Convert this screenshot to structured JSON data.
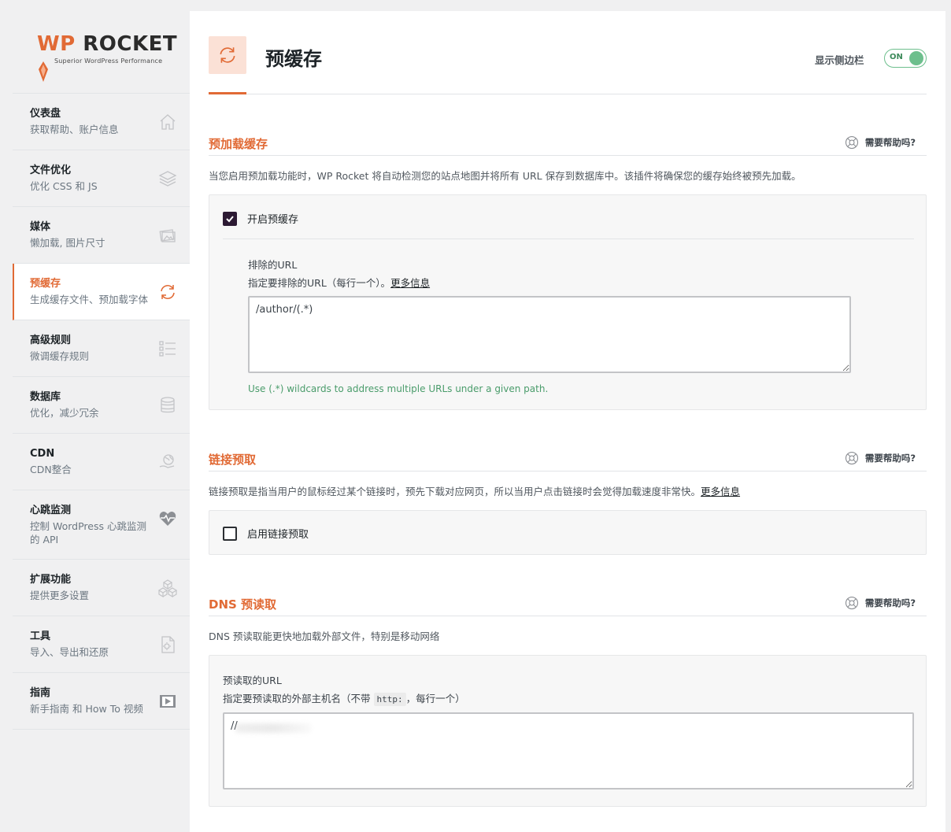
{
  "brand": {
    "wordmark_a": "WP",
    "wordmark_b": " ROCKET",
    "tagline": "Superior WordPress Performance",
    "accent": "#e16a35"
  },
  "sidebar": {
    "items": [
      {
        "title": "仪表盘",
        "sub": "获取帮助、账户信息",
        "icon": "home-icon"
      },
      {
        "title": "文件优化",
        "sub": "优化 CSS 和 JS",
        "icon": "layers-icon"
      },
      {
        "title": "媒体",
        "sub": "懒加载, 图片尺寸",
        "icon": "images-icon"
      },
      {
        "title": "预缓存",
        "sub": "生成缓存文件、预加载字体",
        "icon": "refresh-icon",
        "active": true
      },
      {
        "title": "高级规则",
        "sub": "微调缓存规则",
        "icon": "checklist-icon"
      },
      {
        "title": "数据库",
        "sub": "优化，减少冗余",
        "icon": "database-icon"
      },
      {
        "title": "CDN",
        "sub": "CDN整合",
        "icon": "globe-hand-icon"
      },
      {
        "title": "心跳监测",
        "sub": "控制 WordPress 心跳监测的 API",
        "icon": "heartbeat-icon"
      },
      {
        "title": "扩展功能",
        "sub": "提供更多设置",
        "icon": "cubes-icon"
      },
      {
        "title": "工具",
        "sub": "导入、导出和还原",
        "icon": "tools-file-icon"
      },
      {
        "title": "指南",
        "sub": "新手指南 和 How To 视频",
        "icon": "video-icon"
      }
    ]
  },
  "header": {
    "title": "预缓存",
    "sidebar_toggle_label": "显示侧边栏",
    "toggle_state": "ON"
  },
  "help_label": "需要帮助吗?",
  "preload": {
    "title": "预加载缓存",
    "desc": "当您启用预加载功能时，WP Rocket 将自动检测您的站点地图并将所有 URL 保存到数据库中。该插件将确保您的缓存始终被预先加载。",
    "enable_label": "开启预缓存",
    "enabled": true,
    "exclude_label": "排除的URL",
    "exclude_hint": "指定要排除的URL（每行一个）。",
    "more_info": "更多信息",
    "exclude_value": "/author/(.*)",
    "wildcard_note": "Use (.*) wildcards to address multiple URLs under a given path."
  },
  "link_prefetch": {
    "title": "链接预取",
    "desc": "链接预取是指当用户的鼠标经过某个链接时，预先下载对应网页，所以当用户点击链接时会觉得加载速度非常快。",
    "more_info": "更多信息",
    "enable_label": "启用链接预取",
    "enabled": false
  },
  "dns_prefetch": {
    "title": "DNS 预读取",
    "desc": "DNS 预读取能更快地加载外部文件，特别是移动网络",
    "field_label": "预读取的URL",
    "hint_before": "指定要预读取的外部主机名（不带",
    "hint_code": "http:",
    "hint_after": "，每行一个）",
    "value": "//"
  }
}
